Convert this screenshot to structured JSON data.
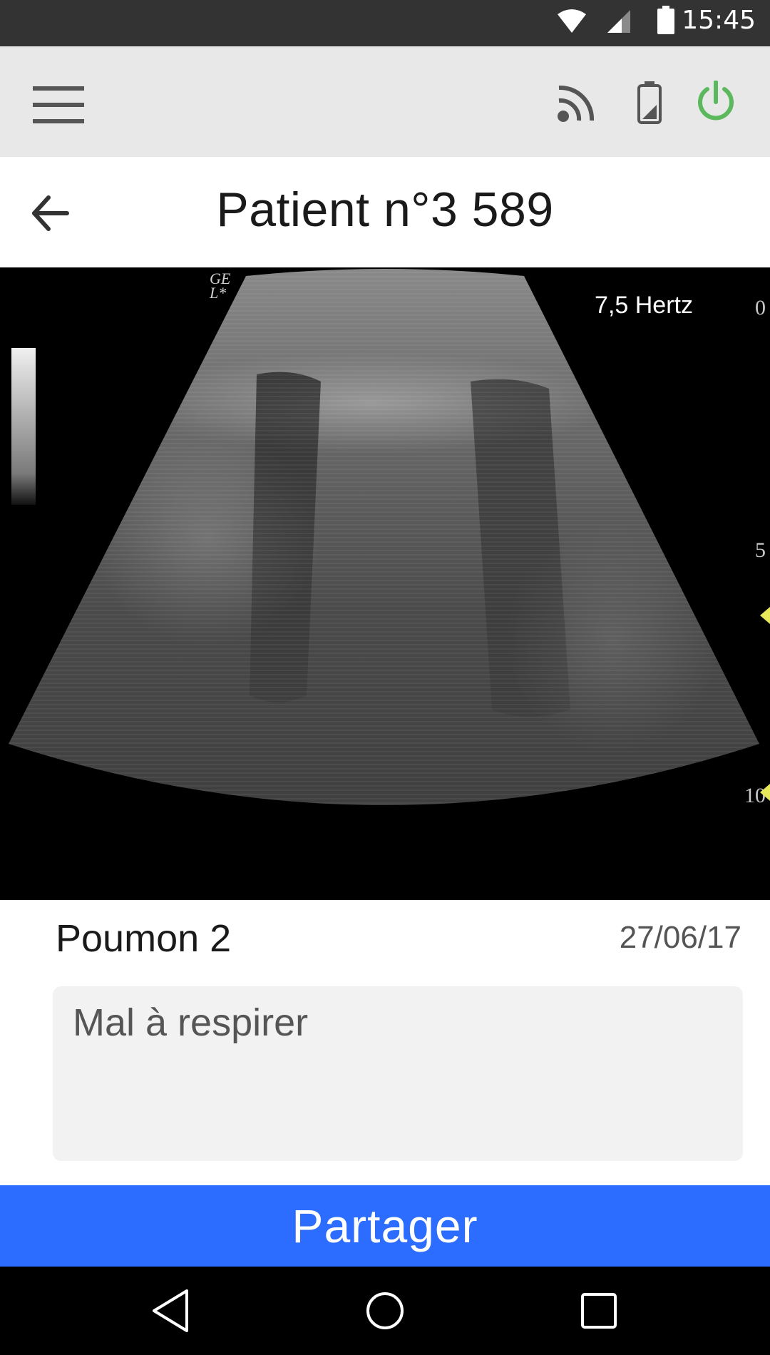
{
  "status_bar": {
    "time": "15:45",
    "icons": [
      "wifi-icon",
      "cell-signal-icon",
      "battery-icon"
    ]
  },
  "toolbar": {
    "menu_icon": "hamburger-menu-icon",
    "actions": [
      "cast-icon",
      "device-battery-icon",
      "power-icon"
    ],
    "power_color": "#5cb85c"
  },
  "header": {
    "back_icon": "arrow-left-icon",
    "title": "Patient n°3 589"
  },
  "image": {
    "frequency": "7,5 Hertz",
    "depth_ticks": [
      "0",
      "5",
      "10"
    ],
    "probe_label": [
      "GE",
      "L*"
    ]
  },
  "record": {
    "name": "Poumon 2",
    "date": "27/06/17",
    "note": "Mal à respirer"
  },
  "actions": {
    "share_label": "Partager",
    "share_color": "#2c6cff"
  },
  "nav_bar": {
    "buttons": [
      "back-triangle-icon",
      "home-circle-icon",
      "recents-square-icon"
    ]
  }
}
